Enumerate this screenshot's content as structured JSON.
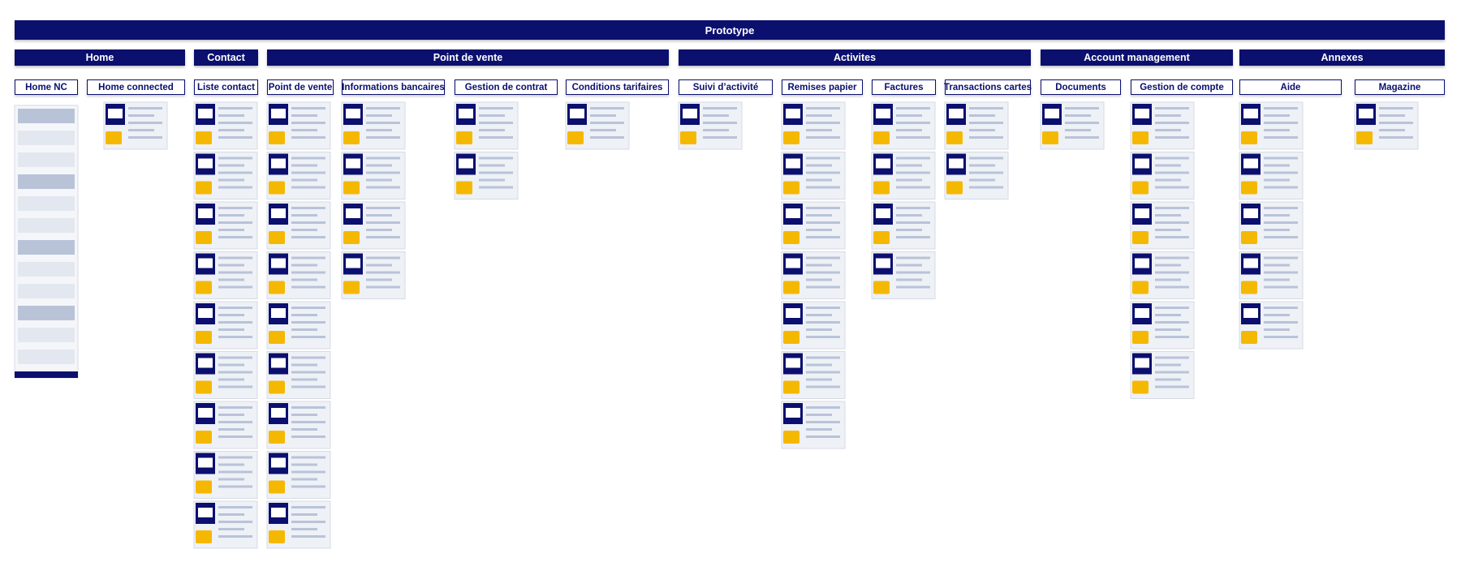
{
  "title": "Prototype",
  "sections": [
    "Home",
    "Contact",
    "Point de vente",
    "Activites",
    "Account management",
    "Annexes"
  ],
  "pages": [
    "Home NC",
    "Home connected",
    "Liste contact",
    "Point de vente",
    "Informations bancaires",
    "Gestion de contrat",
    "Conditions tarifaires",
    "Suivi d’activité",
    "Remises papier",
    "Factures",
    "Transactions cartes",
    "Documents",
    "Gestion de compte",
    "Aide",
    "Magazine"
  ],
  "screens_per_column": [
    1,
    1,
    9,
    9,
    4,
    2,
    1,
    1,
    7,
    4,
    2,
    1,
    6,
    5,
    1
  ],
  "colors": {
    "header": "#0b0f6e",
    "accent": "#f5b800",
    "frame": "#eef1f6"
  }
}
